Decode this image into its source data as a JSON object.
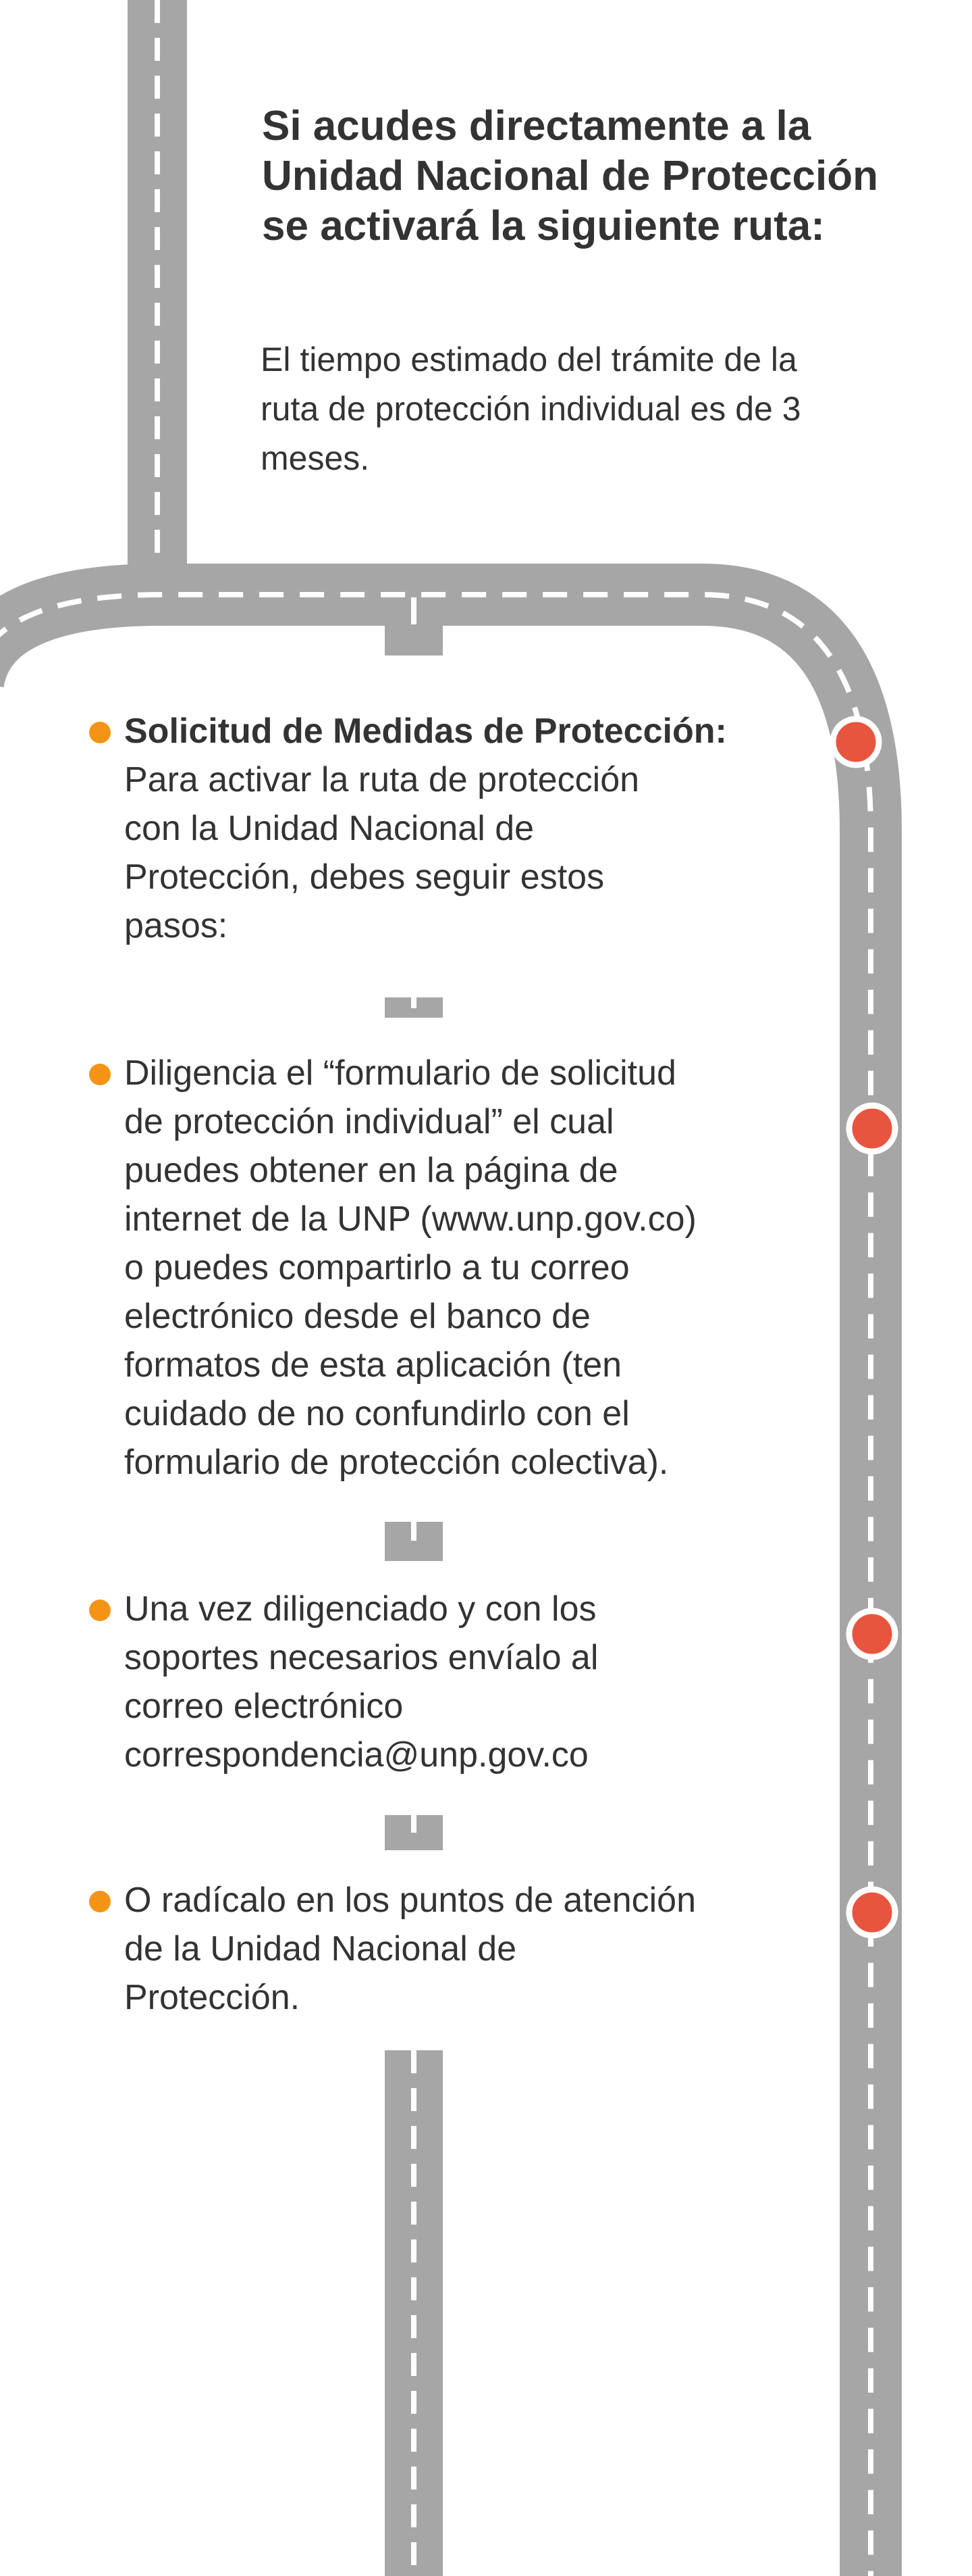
{
  "header": {
    "title_lines": [
      "Si acudes directamente a la",
      "Unidad Nacional de Protección",
      "se activará la siguiente ruta:"
    ],
    "subtitle_lines": [
      "El tiempo estimado del trámite de la",
      "ruta de protección individual es de 3",
      "meses."
    ]
  },
  "steps": [
    {
      "bold": "Solicitud de Medidas de Protección:",
      "lines": [
        "Para activar la ruta de protección",
        "con la Unidad Nacional de",
        "Protección, debes seguir estos",
        "pasos:"
      ]
    },
    {
      "lines": [
        "Diligencia el “formulario de solicitud",
        "de protección individual” el cual",
        "puedes obtener en la página de",
        "internet de la UNP (www.unp.gov.co)",
        "o puedes compartirlo a tu correo",
        "electrónico desde el banco de",
        "formatos de esta aplicación (ten",
        "cuidado de no confundirlo con el",
        "formulario de protección colectiva)."
      ]
    },
    {
      "lines": [
        "Una vez diligenciado y con los",
        "soportes necesarios envíalo al",
        "correo electrónico",
        "correspondencia@unp.gov.co"
      ]
    },
    {
      "lines": [
        "O radícalo en los puntos de atención",
        "de la Unidad Nacional de",
        "Protección."
      ]
    }
  ],
  "colors": {
    "road": "#a6a6a6",
    "road_marking": "#ffffff",
    "bullet": "#f39417",
    "marker": "#e8553f",
    "text": "#333333"
  }
}
